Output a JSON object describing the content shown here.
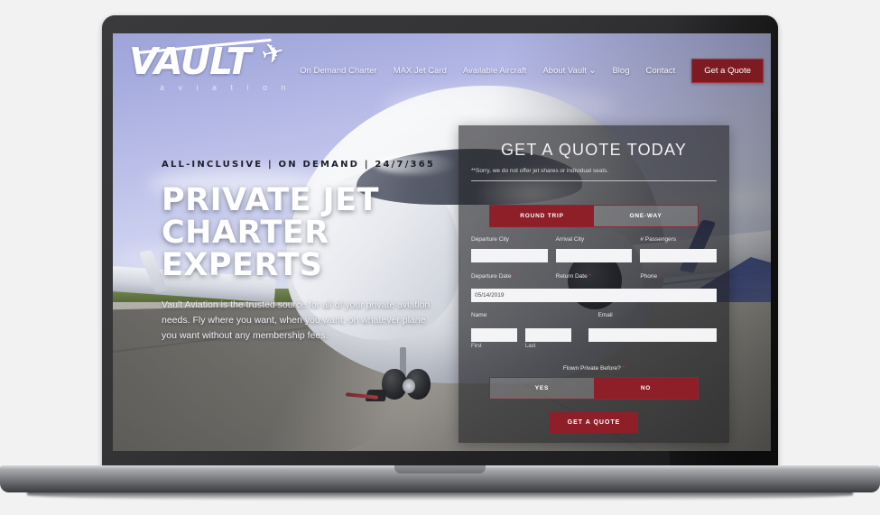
{
  "site": {
    "logo": {
      "word": "VAULT",
      "subtitle": "a v i a t i o n"
    },
    "nav": {
      "links": [
        "On Demand Charter",
        "MAX Jet Card",
        "Available Aircraft",
        "About Vault  ⌄",
        "Blog",
        "Contact"
      ],
      "cta": "Get a Quote"
    }
  },
  "hero": {
    "eyebrow": "ALL-INCLUSIVE | ON DEMAND | 24/7/365",
    "title_line1": "PRIVATE JET",
    "title_line2": "CHARTER",
    "title_line3": "EXPERTS",
    "body": "Vault Aviation is the trusted source for all of your private aviation needs. Fly where you want, when you want, on whatever plane you want without any membership fees."
  },
  "quote_form": {
    "title": "GET A QUOTE TODAY",
    "note": "**Sorry, we do not offer jet shares or individual seats.",
    "trip_type": {
      "round_trip": "ROUND TRIP",
      "one_way": "ONE-WAY",
      "selected": "ROUND TRIP"
    },
    "fields": {
      "departure_city": {
        "label": "Departure City",
        "value": "",
        "required": "*"
      },
      "arrival_city": {
        "label": "Arrival City",
        "value": "",
        "required": "*"
      },
      "passengers": {
        "label": "# Passengers",
        "value": "",
        "required": "*"
      },
      "departure_date": {
        "label": "Departure Date",
        "value": "05/14/2019",
        "required": "*"
      },
      "return_date": {
        "label": "Return Date",
        "value": "",
        "required": "*"
      },
      "phone": {
        "label": "Phone",
        "value": "",
        "required": "*"
      },
      "name": {
        "label": "Name",
        "required": "*",
        "first_sub": "First",
        "last_sub": "Last",
        "first_value": "",
        "last_value": ""
      },
      "email": {
        "label": "Email",
        "value": "",
        "required": "*"
      }
    },
    "flown_before": {
      "label": "Flown Private Before?",
      "required": "*",
      "yes": "YES",
      "no": "NO",
      "selected": "NO"
    },
    "submit": "GET A QUOTE"
  },
  "colors": {
    "brand_red": "#8e1f28",
    "nav_cta_red": "#7d1a22",
    "panel_overlay": "rgba(36,36,38,.62)"
  }
}
